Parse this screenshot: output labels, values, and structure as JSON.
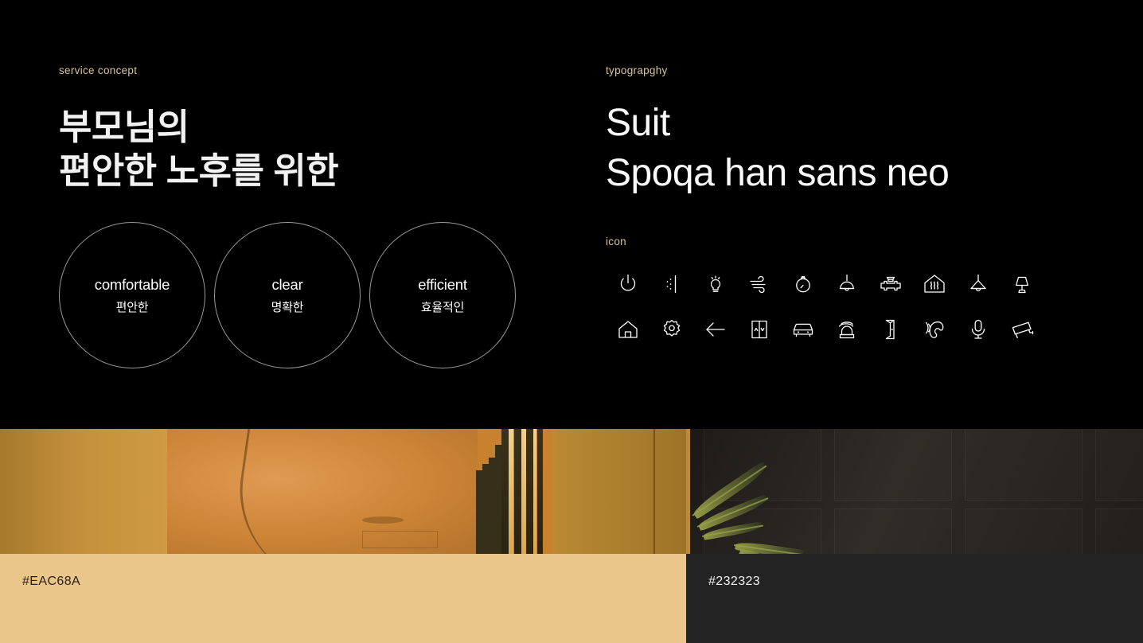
{
  "sections": {
    "service_concept": {
      "label": "service concept",
      "headline_line1": "부모님의",
      "headline_line2": "편안한 노후를 위한",
      "circles": [
        {
          "en": "comfortable",
          "ko": "편안한"
        },
        {
          "en": "clear",
          "ko": "명확한"
        },
        {
          "en": "efficient",
          "ko": "효율적인"
        }
      ]
    },
    "typography": {
      "label": "typograpghy",
      "font_1": "Suit",
      "font_2": "Spoqa han sans neo"
    },
    "icon": {
      "label": "icon",
      "items": [
        "power-icon",
        "dotted-divider-icon",
        "light-bulb-icon",
        "wind-airflow-icon",
        "thermostat-gauge-icon",
        "pendant-lamp-icon",
        "pipe-valve-icon",
        "house-heating-icon",
        "cone-pendant-light-icon",
        "table-lamp-icon",
        "home-icon",
        "brightness-sun-icon",
        "arrow-left-icon",
        "elevator-icon",
        "car-icon",
        "siren-alarm-icon",
        "door-open-icon",
        "phone-ringing-icon",
        "microphone-icon",
        "cctv-camera-icon"
      ]
    },
    "colors": {
      "swatches": [
        {
          "code": "#EAC68A",
          "hex": "#EAC68A",
          "text_color": "#2a2017"
        },
        {
          "code": "#232323",
          "hex": "#232323",
          "text_color": "#f0f0f0"
        }
      ]
    }
  },
  "theme": {
    "background": "#000000",
    "label_color": "#d8c39a",
    "text_color": "#ffffff",
    "circle_stroke": "#9a9a9a"
  }
}
